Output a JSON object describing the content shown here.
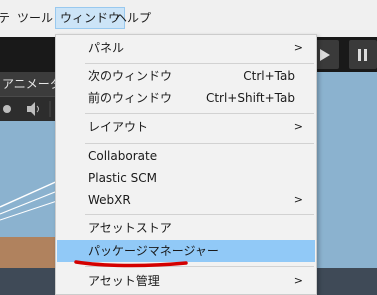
{
  "menubar": {
    "items": [
      {
        "label": "テ"
      },
      {
        "label": "ツール"
      },
      {
        "label": "ウィンドウ"
      },
      {
        "label": "ヘルプ"
      }
    ]
  },
  "background": {
    "animator_tab": "アニメータ"
  },
  "dropdown": {
    "items": [
      {
        "label": "パネル",
        "submenu": true
      },
      {
        "label": "次のウィンドウ",
        "shortcut": "Ctrl+Tab"
      },
      {
        "label": "前のウィンドウ",
        "shortcut": "Ctrl+Shift+Tab"
      },
      {
        "label": "レイアウト",
        "submenu": true
      },
      {
        "label": "Collaborate"
      },
      {
        "label": "Plastic SCM"
      },
      {
        "label": "WebXR",
        "submenu": true
      },
      {
        "label": "アセットストア"
      },
      {
        "label": "パッケージマネージャー"
      },
      {
        "label": "アセット管理",
        "submenu": true
      }
    ],
    "submenu_arrow": ">"
  },
  "colors": {
    "highlight": "#91c9f7",
    "annotation_red": "#d40000"
  }
}
